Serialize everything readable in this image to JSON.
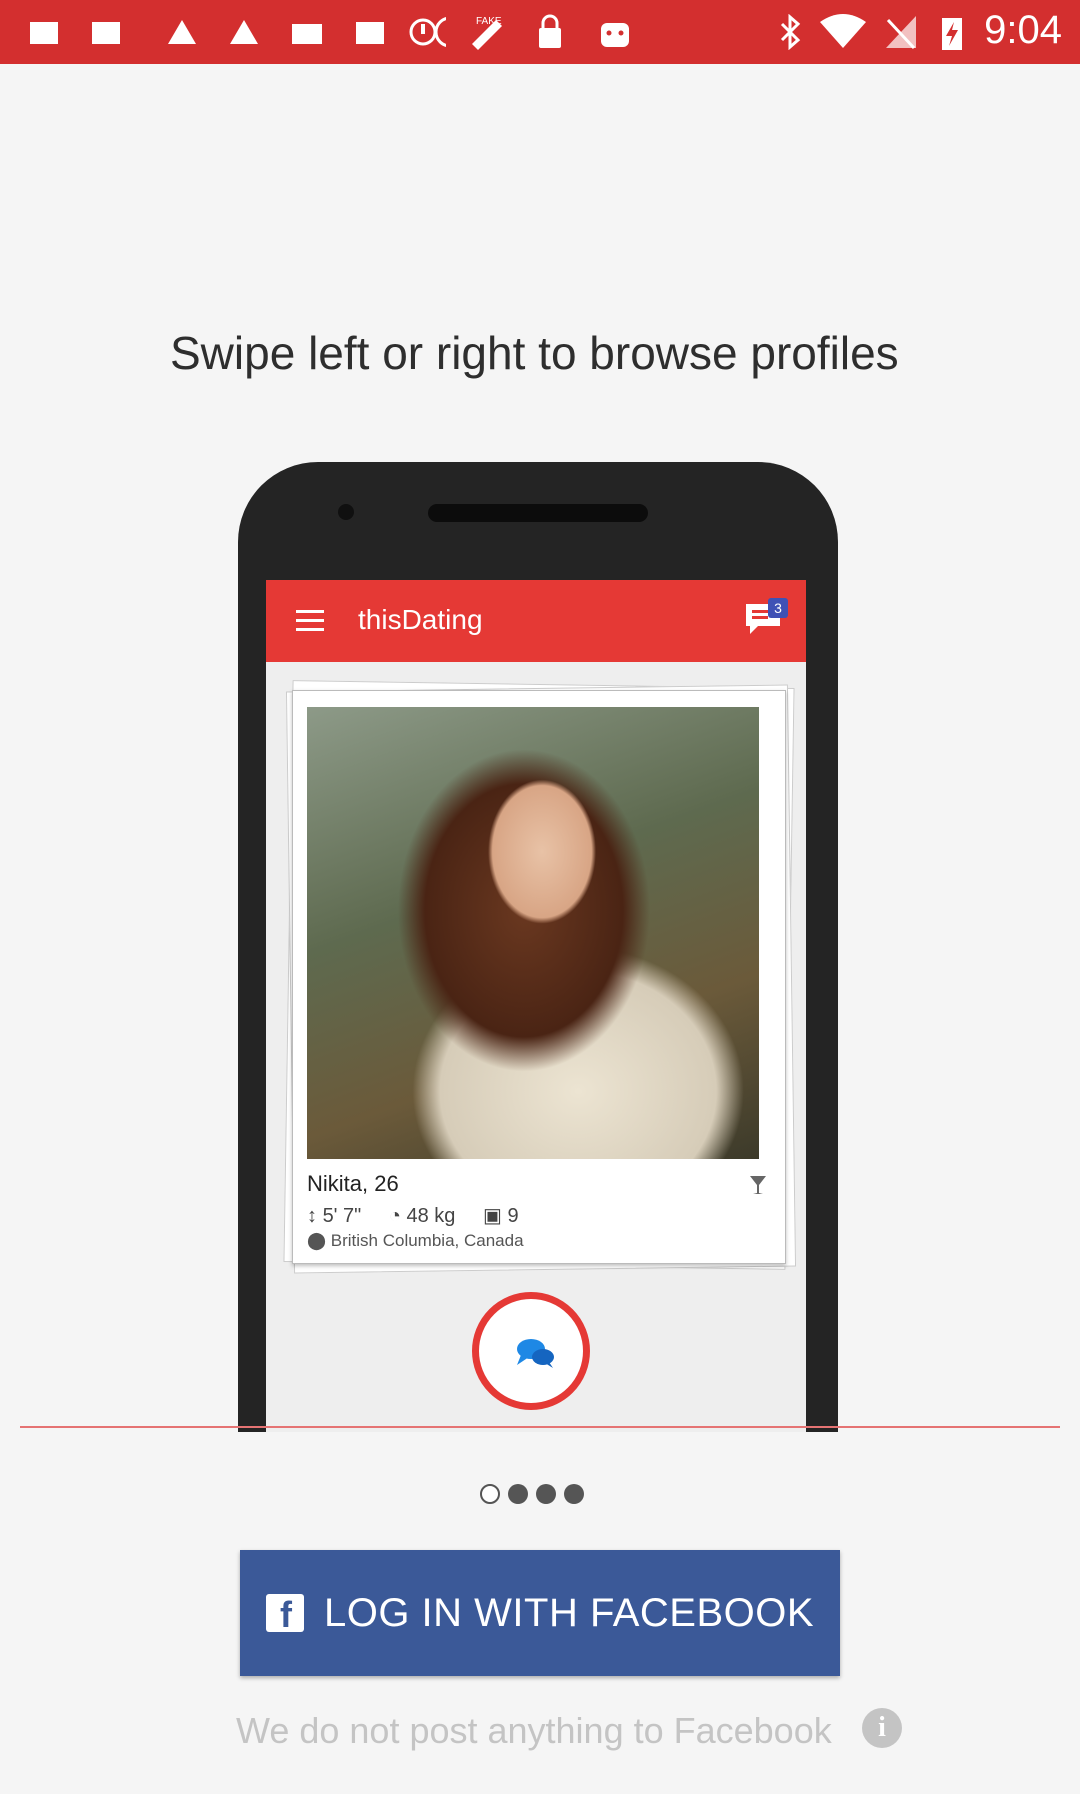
{
  "status_bar": {
    "time": "9:04",
    "icons": [
      "notification-icon",
      "notification-icon",
      "notification-icon",
      "warning-icon",
      "mail-icon",
      "notification-icon",
      "sync-icon",
      "fake-gps-icon",
      "lock-icon",
      "android-icon",
      "bluetooth-icon",
      "wifi-icon",
      "no-signal-icon",
      "battery-charging-icon"
    ],
    "background": "#d32f2f"
  },
  "intro": {
    "instruction": "Swipe left or right to browse profiles"
  },
  "preview": {
    "app_title": "thisDating",
    "chat_badge": "3",
    "profile": {
      "name": "Nikita, 26",
      "height": "5' 7\"",
      "weight": "48 kg",
      "photos": "9",
      "location": "British Columbia, Canada"
    },
    "accent": "#e53935"
  },
  "pager": {
    "pages": 4,
    "active_index": 0
  },
  "login": {
    "facebook_label": "LOG IN WITH FACEBOOK",
    "facebook_color": "#3b5998",
    "disclaimer": "We do not post anything to Facebook"
  }
}
